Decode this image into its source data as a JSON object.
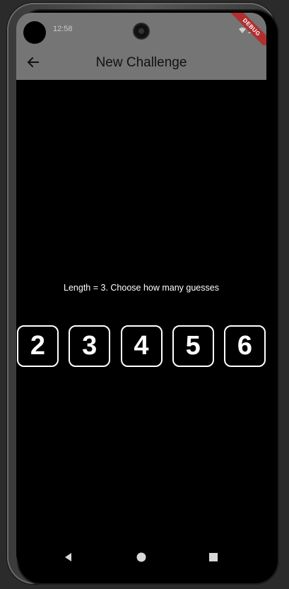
{
  "status_bar": {
    "time": "12:58"
  },
  "app_bar": {
    "title": "New Challenge",
    "back_icon": "arrow-left-icon"
  },
  "debug_banner": "DEBUG",
  "prompt": "Length = 3.   Choose how many guesses",
  "choices": [
    "2",
    "3",
    "4",
    "5",
    "6"
  ],
  "colors": {
    "app_bar": "#757575",
    "background": "#000000",
    "choice_border": "#ffffff",
    "debug_ribbon": "#b03030"
  },
  "nav_bar": {
    "back_icon": "triangle-back-icon",
    "home_icon": "circle-home-icon",
    "recents_icon": "square-recents-icon"
  }
}
